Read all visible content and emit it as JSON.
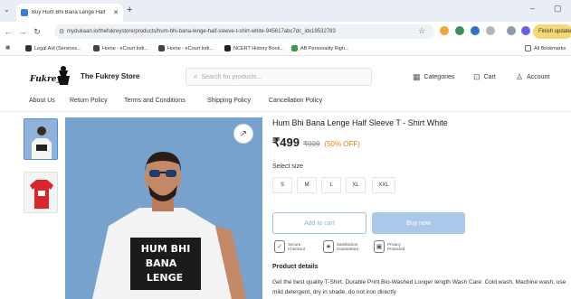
{
  "browser": {
    "tab_title": "Buy Hum Bhi Bana Lenge Half",
    "new_tab": "+",
    "url": "mydukaan.io/thefukreystore/products/hum-bhi-bana-lenge-half-sleeve-t-shirt-white-945617abc7dc_idx19532783",
    "finish_update": "Finish update",
    "bookmarks": [
      "Legal Aid (Services...",
      "Home - eCourt Indi...",
      "Home - eCourt Indi...",
      "NCERT History Book...",
      "AB Personality Righ..."
    ],
    "all_bookmarks": "All Bookmarks"
  },
  "header": {
    "logo_text": "Fukrey",
    "store_name": "The Fukrey Store",
    "search_placeholder": "Search for products...",
    "categories": "Categories",
    "cart": "Cart",
    "account": "Account"
  },
  "menu": [
    "About Us",
    "Return Policy",
    "Terms and Conditions",
    "Shipping Policy",
    "Cancellation Policy"
  ],
  "product": {
    "title": "Hum Bhi Bana Lenge Half Sleeve T - Shirt White",
    "price": "₹499",
    "mrp": "₹999",
    "discount": "(50% OFF)",
    "size_label": "Select size",
    "sizes": [
      "S",
      "M",
      "L",
      "XL",
      "XXL"
    ],
    "add_to_cart": "Add to cart",
    "buy_now": "Buy now",
    "badges": [
      {
        "text": "Secure Checkout"
      },
      {
        "text": "Satisfaction Guaranteed"
      },
      {
        "text": "Privacy Protected"
      }
    ],
    "details_heading": "Product details",
    "details_text": "Get the best quality T-Shirt. Durable Print Bio-Washed Longer length Wash Care: Cold wash, Machine wash, use mild detergent, dry in shade, do not iron directly",
    "shirt_print": [
      "HUM BHI",
      "BANA",
      "LENGE"
    ]
  },
  "colors": {
    "accent": "#e47f14",
    "buy_button": "#a9c8ea",
    "image_background": "#79a3cf"
  }
}
